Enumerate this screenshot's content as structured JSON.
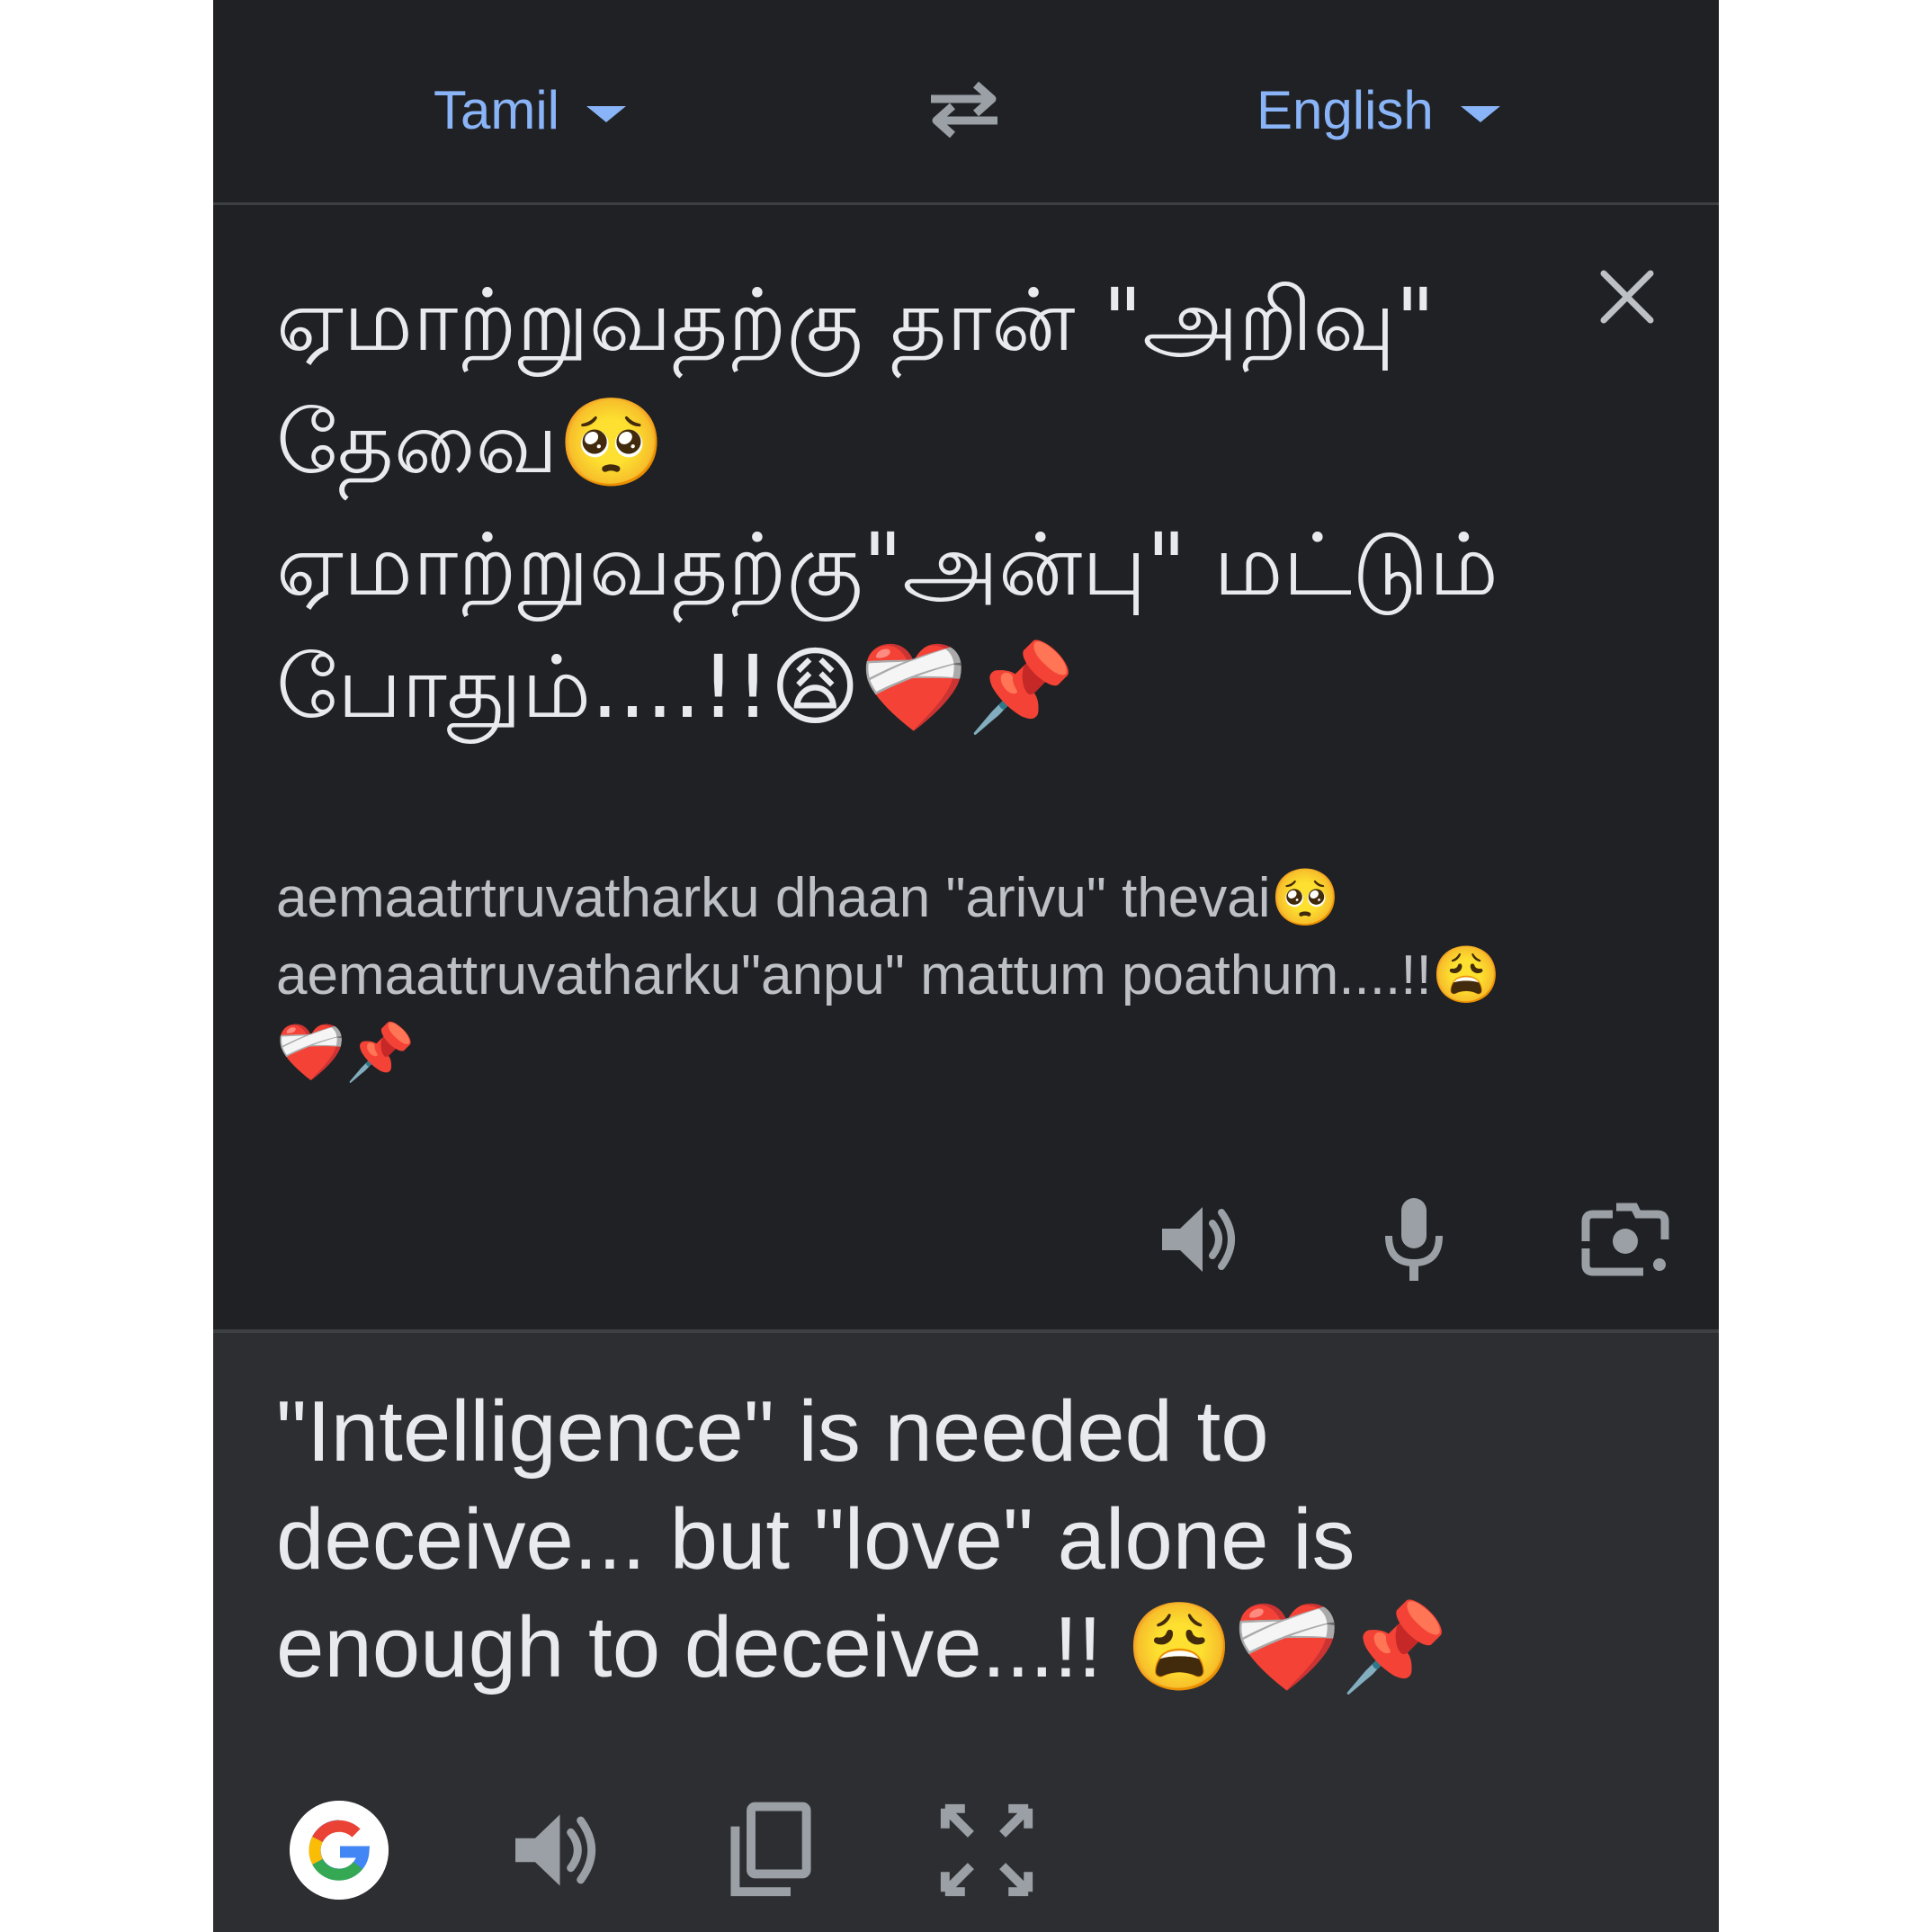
{
  "languages": {
    "source": "Tamil",
    "target": "English"
  },
  "source": {
    "text": "ஏமாற்றுவதற்கு தான் \"அறிவு\" தேவை🥺 ஏமாற்றுவதற்கு\"அன்பு\" மட்டும் போதும்....!!😩❤️‍🩹📌",
    "transliteration": "aemaatrtruvatharku dhaan \"arivu\" thevai🥺 aemaattruvatharku\"anpu\" mattum poathum....!!😩❤️‍🩹📌"
  },
  "target": {
    "text": "\"Intelligence\" is needed to deceive... but \"love\" alone is enough to deceive...!! 😩❤️‍🩹📌"
  },
  "icons": {
    "swap": "swap-arrows-icon",
    "clear": "close-icon",
    "listen_source": "speaker-icon",
    "mic": "microphone-icon",
    "camera": "camera-icon",
    "google": "google-logo-icon",
    "listen_target": "speaker-icon",
    "copy": "copy-icon",
    "fullscreen": "fullscreen-icon"
  },
  "colors": {
    "background": "#202124",
    "target_background": "#2d2e31",
    "accent": "#8ab4f8",
    "text": "#e8eaed",
    "icon": "#9aa0a6"
  }
}
